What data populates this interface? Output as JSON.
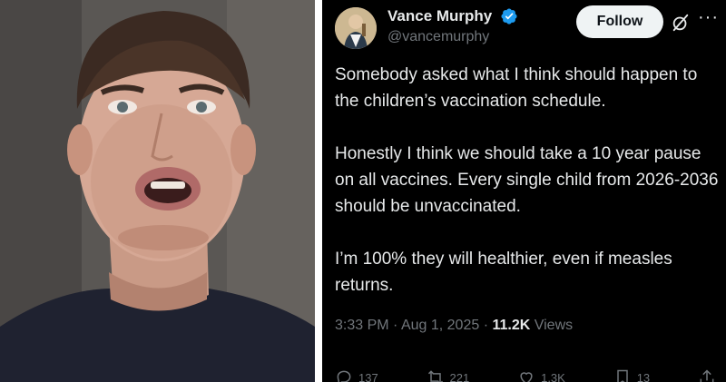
{
  "tweet": {
    "display_name": "Vance Murphy",
    "handle": "@vancemurphy",
    "follow_label": "Follow",
    "more_label": "···",
    "paragraphs": [
      "Somebody asked what I think should happen to the children’s vaccination schedule.",
      "Honestly I think we should take a 10 year pause on all vaccines. Every single child from 2026-2036 should be unvaccinated.",
      "I’m 100% they will healthier, even if measles returns."
    ],
    "time": "3:33 PM",
    "date": "Aug 1, 2025",
    "views_count": "11.2K",
    "views_label": "Views",
    "actions": {
      "replies": "137",
      "reposts": "221",
      "likes": "1.3K",
      "bookmarks": "13"
    },
    "colors": {
      "background": "#000000",
      "text": "#e7e9ea",
      "secondary": "#71767b",
      "verified": "#1d9bf0",
      "follow_bg": "#eff3f4"
    }
  },
  "icons": {
    "verified": "verified-badge-icon",
    "grok": "grok-icon",
    "more": "more-icon",
    "reply": "reply-icon",
    "repost": "repost-icon",
    "like": "like-icon",
    "bookmark": "bookmark-icon",
    "share": "share-icon"
  }
}
